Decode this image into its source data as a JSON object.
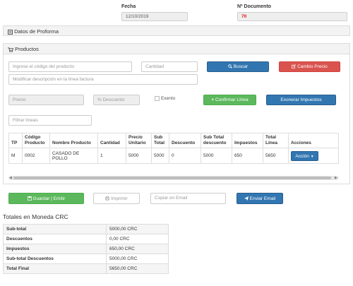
{
  "header": {
    "fecha_label": "Fecha",
    "fecha_value": "12/10/2019",
    "doc_label": "Nº Documento",
    "doc_value": "70"
  },
  "proforma": {
    "title": "Datos de Proforma"
  },
  "productos": {
    "title": "Productos",
    "codigo_placeholder": "Ingrese el código del producto",
    "cantidad_placeholder": "Cantidad",
    "buscar_label": "Buscar",
    "cambio_precio_label": "Cambio Precio",
    "descripcion_placeholder": "Modificar descripción en la línea factura",
    "precio_placeholder": "Precio",
    "descuento_placeholder": "% Descuento",
    "exento_label": "Exento",
    "confirmar_label": "Confirmar Línea",
    "exonerar_label": "Exonerar Impuestos",
    "filtrar_placeholder": "Filtrar líneas"
  },
  "table": {
    "headers": [
      "TP",
      "Código Producto",
      "Nombre Producto",
      "Cantidad",
      "Precio Unitario",
      "Sub Total",
      "Descuento",
      "Sub Total descuento",
      "Impuestos",
      "Total Línea",
      "Acciones"
    ],
    "rows": [
      {
        "tp": "M",
        "codigo": "0002",
        "nombre": "CASADO DE POLLO",
        "cantidad": "1",
        "precio": "5000",
        "subtotal": "5000",
        "descuento": "0",
        "subtotal_desc": "5000",
        "impuestos": "650",
        "total": "5650",
        "accion": "Acción"
      }
    ]
  },
  "actions": {
    "guardar_label": "Guardar | Emitir",
    "imprimir_label": "Imprimir",
    "email_placeholder": "Copiar en Email",
    "enviar_label": "Enviar Email"
  },
  "totals": {
    "title": "Totales en Moneda CRC",
    "rows": [
      {
        "label": "Sub-total",
        "value": "5000,00 CRC"
      },
      {
        "label": "Descuentos",
        "value": "0,00 CRC"
      },
      {
        "label": "Impuestos",
        "value": "650,00 CRC"
      },
      {
        "label": "Sub-total Descuentos",
        "value": "5000,00 CRC"
      },
      {
        "label": "Total Final",
        "value": "5650,00 CRC"
      }
    ]
  },
  "colors": {
    "doc_number": "#e0120b",
    "primary": "#3276b1",
    "danger": "#d9534f",
    "success": "#5cb85c"
  }
}
